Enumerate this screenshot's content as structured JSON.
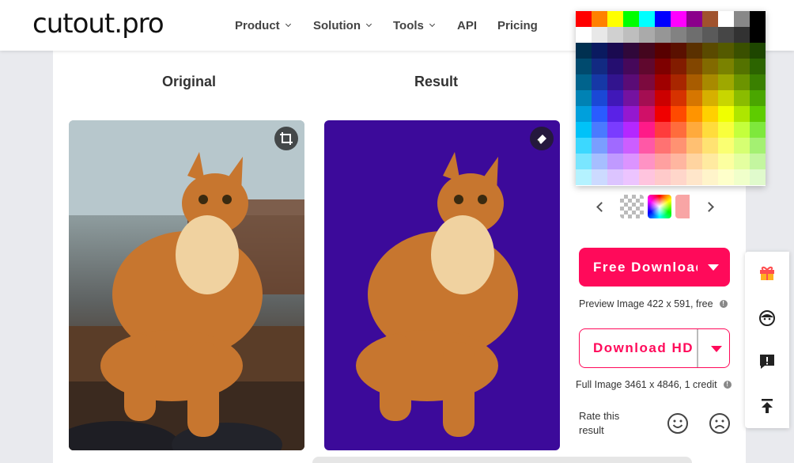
{
  "header": {
    "logo": "cutout.pro",
    "nav": [
      {
        "label": "Product",
        "dropdown": true
      },
      {
        "label": "Solution",
        "dropdown": true
      },
      {
        "label": "Tools",
        "dropdown": true
      },
      {
        "label": "API",
        "dropdown": false
      },
      {
        "label": "Pricing",
        "dropdown": false
      }
    ]
  },
  "columns": {
    "original_title": "Original",
    "result_title": "Result"
  },
  "icons": {
    "crop": "crop-icon",
    "eraser": "eraser-icon"
  },
  "palette": {
    "rows": [
      [
        "#ff0000",
        "#ff8000",
        "#ffff00",
        "#00ff00",
        "#00ffff",
        "#0000ff",
        "#ff00ff",
        "#8b008b",
        "#a0522d",
        "#ffffff",
        "#888888",
        "#000000"
      ],
      [
        "#ffffff",
        "#e8e8e8",
        "#d0d0d0",
        "#bebebe",
        "#aaaaaa",
        "#969696",
        "#828282",
        "#6e6e6e",
        "#5a5a5a",
        "#464646",
        "#323232",
        "#000000"
      ],
      [
        "#003050",
        "#0a1a60",
        "#1a0a50",
        "#30083a",
        "#44061e",
        "#580000",
        "#5a1000",
        "#5a3000",
        "#5a4a00",
        "#545a00",
        "#3a5000",
        "#1e4600"
      ],
      [
        "#004a6e",
        "#122a82",
        "#250e70",
        "#46085a",
        "#60082e",
        "#7e0000",
        "#821c00",
        "#824600",
        "#826a00",
        "#7a8200",
        "#547200",
        "#2c6400"
      ],
      [
        "#00638c",
        "#1638a6",
        "#32148e",
        "#5a0c76",
        "#7c0a3e",
        "#a00000",
        "#a82600",
        "#a85c00",
        "#a88a00",
        "#9ea800",
        "#6c9400",
        "#3a8000"
      ],
      [
        "#0082b4",
        "#1a48d6",
        "#4018b8",
        "#7412a0",
        "#a40e52",
        "#cc0000",
        "#d63200",
        "#d67600",
        "#d6b000",
        "#c8d600",
        "#8abc00",
        "#4aa600"
      ],
      [
        "#00a0dc",
        "#2a5cff",
        "#5a22e6",
        "#9418d0",
        "#d01068",
        "#f00000",
        "#ff4a00",
        "#ff9400",
        "#ffd000",
        "#f0ff00",
        "#aee600",
        "#5ecc00"
      ],
      [
        "#00c2f8",
        "#4a7aff",
        "#7a3cff",
        "#b428ff",
        "#ff1a88",
        "#ff3c3c",
        "#ff6c3c",
        "#ffaa3c",
        "#ffdc3c",
        "#f8ff3c",
        "#c4ff3c",
        "#7ee83c"
      ],
      [
        "#3cd8ff",
        "#7a9eff",
        "#a06aff",
        "#cc5eff",
        "#ff58a6",
        "#ff7272",
        "#ff9272",
        "#ffc072",
        "#ffe272",
        "#faff72",
        "#d6ff72",
        "#a4f072"
      ],
      [
        "#7ae6ff",
        "#a6beff",
        "#c09aff",
        "#dc94ff",
        "#ff92c4",
        "#ffa0a0",
        "#ffb6a0",
        "#ffd4a0",
        "#ffeaa0",
        "#fcffa0",
        "#e4ffa0",
        "#c4f6a0"
      ],
      [
        "#b4f2ff",
        "#ccdaff",
        "#dcc4ff",
        "#ecc4ff",
        "#ffc4de",
        "#ffcaca",
        "#ffd6ca",
        "#ffe6ca",
        "#fff4ca",
        "#feffca",
        "#f0ffca",
        "#e0facc"
      ]
    ]
  },
  "swatches": [
    "transparent-swatch",
    "rainbow-swatch",
    "pink-swatch"
  ],
  "download": {
    "free_label": "Free Download",
    "preview_note": "Preview Image 422 x 591, free",
    "hd_label": "Download HD",
    "full_note": "Full Image 3461 x 4846, 1 credit"
  },
  "rating": {
    "label": "Rate this result"
  },
  "side_toolbar": [
    "gift-icon",
    "support-icon",
    "feedback-icon",
    "back-to-top-icon"
  ]
}
